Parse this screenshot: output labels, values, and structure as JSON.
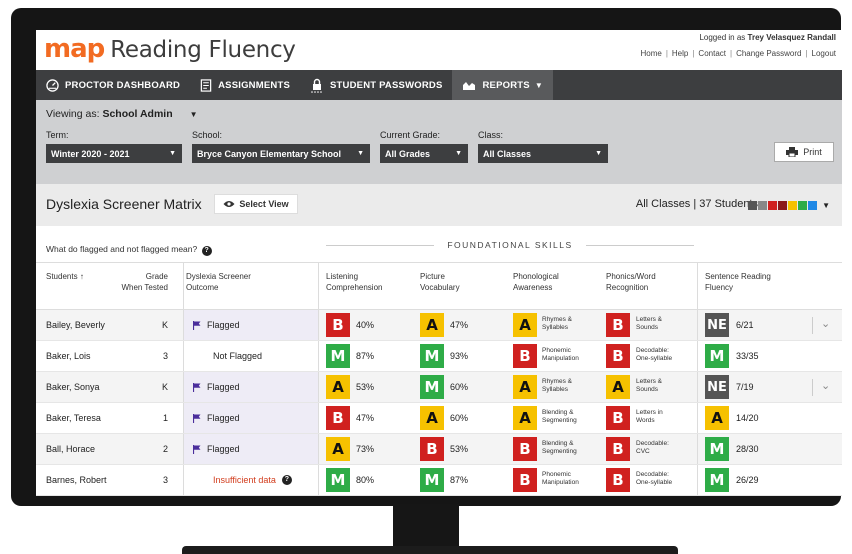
{
  "app": {
    "logo_map": "map",
    "logo_rest": "Reading Fluency"
  },
  "user": {
    "prefix": "Logged in as",
    "name": "Trey Velasquez Randall"
  },
  "top_links": [
    "Home",
    "Help",
    "Contact",
    "Change Password",
    "Logout"
  ],
  "nav": [
    {
      "label": "PROCTOR DASHBOARD",
      "icon": "proctor-dashboard-icon"
    },
    {
      "label": "ASSIGNMENTS",
      "icon": "assignments-icon"
    },
    {
      "label": "STUDENT PASSWORDS",
      "icon": "lock-icon"
    },
    {
      "label": "REPORTS",
      "icon": "reports-icon",
      "active": true
    }
  ],
  "filters": {
    "viewing_prefix": "Viewing as:",
    "viewing_role": "School Admin",
    "term": {
      "label": "Term:",
      "value": "Winter 2020 - 2021"
    },
    "school": {
      "label": "School:",
      "value": "Bryce Canyon Elementary School"
    },
    "grade": {
      "label": "Current Grade:",
      "value": "All Grades"
    },
    "class": {
      "label": "Class:",
      "value": "All Classes"
    },
    "print_label": "Print"
  },
  "matrix": {
    "title": "Dyslexia Screener Matrix",
    "select_view_label": "Select View",
    "summary": "All Classes | 37 Students",
    "swatches": [
      "#555555",
      "#888888",
      "#d0211f",
      "#8c1a1a",
      "#f6c100",
      "#2eac47",
      "#1e88e5"
    ]
  },
  "table": {
    "faq": "What do flagged and not flagged mean?",
    "section_label": "FOUNDATIONAL SKILLS",
    "headers": {
      "students": "Students",
      "grade1": "Grade",
      "grade2": "When Tested",
      "outcome1": "Dyslexia Screener",
      "outcome2": "Outcome",
      "listening1": "Listening",
      "listening2": "Comprehension",
      "picture1": "Picture",
      "picture2": "Vocabulary",
      "phono1": "Phonological",
      "phono2": "Awareness",
      "phonics1": "Phonics/Word",
      "phonics2": "Recognition",
      "srf1": "Sentence Reading",
      "srf2": "Fluency"
    },
    "rows": [
      {
        "name": "Bailey, Beverly",
        "grade": "K",
        "outcome": "Flagged",
        "status": "flag",
        "listening": {
          "level": "B",
          "pct": "40%"
        },
        "picture": {
          "level": "A",
          "pct": "47%"
        },
        "phono": {
          "level": "A",
          "sub": [
            "Rhymes &",
            "Syllables"
          ]
        },
        "phonics": {
          "level": "B",
          "sub": [
            "Letters &",
            "Sounds"
          ]
        },
        "srf": {
          "level": "NE",
          "score": "6/21"
        },
        "expand": true
      },
      {
        "name": "Baker, Lois",
        "grade": "3",
        "outcome": "Not Flagged",
        "status": "none",
        "listening": {
          "level": "M",
          "pct": "87%"
        },
        "picture": {
          "level": "M",
          "pct": "93%"
        },
        "phono": {
          "level": "B",
          "sub": [
            "Phonemic",
            "Manipulation"
          ]
        },
        "phonics": {
          "level": "B",
          "sub": [
            "Decodable:",
            "One-syllable"
          ]
        },
        "srf": {
          "level": "M",
          "score": "33/35"
        },
        "expand": false
      },
      {
        "name": "Baker, Sonya",
        "grade": "K",
        "outcome": "Flagged",
        "status": "flag",
        "listening": {
          "level": "A",
          "pct": "53%"
        },
        "picture": {
          "level": "M",
          "pct": "60%"
        },
        "phono": {
          "level": "A",
          "sub": [
            "Rhymes &",
            "Syllables"
          ]
        },
        "phonics": {
          "level": "A",
          "sub": [
            "Letters &",
            "Sounds"
          ]
        },
        "srf": {
          "level": "NE",
          "score": "7/19"
        },
        "expand": true
      },
      {
        "name": "Baker, Teresa",
        "grade": "1",
        "outcome": "Flagged",
        "status": "flag",
        "listening": {
          "level": "B",
          "pct": "47%"
        },
        "picture": {
          "level": "A",
          "pct": "60%"
        },
        "phono": {
          "level": "A",
          "sub": [
            "Blending &",
            "Segmenting"
          ]
        },
        "phonics": {
          "level": "B",
          "sub": [
            "Letters in",
            "Words"
          ]
        },
        "srf": {
          "level": "A",
          "score": "14/20"
        },
        "expand": false
      },
      {
        "name": "Ball, Horace",
        "grade": "2",
        "outcome": "Flagged",
        "status": "flag",
        "listening": {
          "level": "A",
          "pct": "73%"
        },
        "picture": {
          "level": "B",
          "pct": "53%"
        },
        "phono": {
          "level": "B",
          "sub": [
            "Blending &",
            "Segmenting"
          ]
        },
        "phonics": {
          "level": "B",
          "sub": [
            "Decodable:",
            "CVC"
          ]
        },
        "srf": {
          "level": "M",
          "score": "28/30"
        },
        "expand": false
      },
      {
        "name": "Barnes, Robert",
        "grade": "3",
        "outcome": "Insufficient data",
        "status": "insufficient",
        "listening": {
          "level": "M",
          "pct": "80%"
        },
        "picture": {
          "level": "M",
          "pct": "87%"
        },
        "phono": {
          "level": "B",
          "sub": [
            "Phonemic",
            "Manipulation"
          ]
        },
        "phonics": {
          "level": "B",
          "sub": [
            "Decodable:",
            "One-syllable"
          ]
        },
        "srf": {
          "level": "M",
          "score": "26/29"
        },
        "expand": false
      }
    ]
  }
}
